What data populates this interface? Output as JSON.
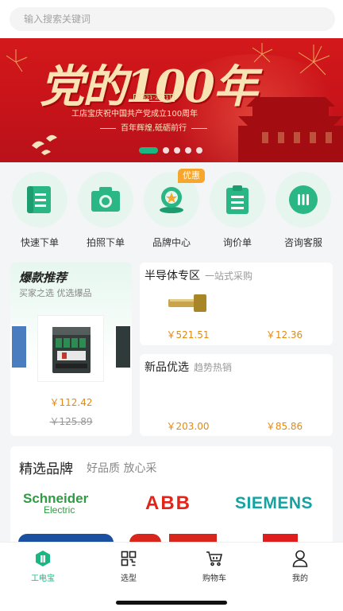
{
  "search": {
    "placeholder": "输入搜索关键词"
  },
  "banner": {
    "headline": "党的100年",
    "years": "[1921-2021]",
    "line1": "工店宝庆祝中国共产党成立100周年",
    "line2": "百年辉煌,砥砺前行",
    "slide_count": 5,
    "active_slide": 1
  },
  "quick_menu": [
    {
      "label": "快速下单",
      "icon": "quick-order-icon"
    },
    {
      "label": "拍照下单",
      "icon": "camera-icon"
    },
    {
      "label": "品牌中心",
      "icon": "brand-center-icon"
    },
    {
      "label": "询价单",
      "icon": "inquiry-icon"
    },
    {
      "label": "咨询客服",
      "icon": "customer-service-icon"
    }
  ],
  "promo_badge": "优惠",
  "hot": {
    "title": "爆款推荐",
    "subtitle": "买家之选 优选爆品",
    "price": "￥112.42",
    "old_price": "￥125.89"
  },
  "semiconductor": {
    "title": "半导体专区",
    "subtitle": "一站式采购",
    "price1": "￥521.51",
    "price2": "￥12.36"
  },
  "new_products": {
    "title": "新品优选",
    "subtitle": "趋势热销",
    "price1": "￥203.00",
    "price2": "￥85.86"
  },
  "brands": {
    "title": "精选品牌",
    "subtitle": "好品质 放心采",
    "items": [
      "Schneider",
      "Electric",
      "ABB",
      "SIEMENS"
    ]
  },
  "tabs": [
    {
      "label": "工电宝",
      "icon": "home-icon",
      "active": true
    },
    {
      "label": "选型",
      "icon": "grid-icon",
      "active": false
    },
    {
      "label": "购物车",
      "icon": "cart-icon",
      "active": false
    },
    {
      "label": "我的",
      "icon": "user-icon",
      "active": false
    }
  ],
  "colors": {
    "accent": "#1bb783",
    "price": "#e28a12",
    "banner_red": "#c7131a",
    "badge": "#f6a62a"
  }
}
